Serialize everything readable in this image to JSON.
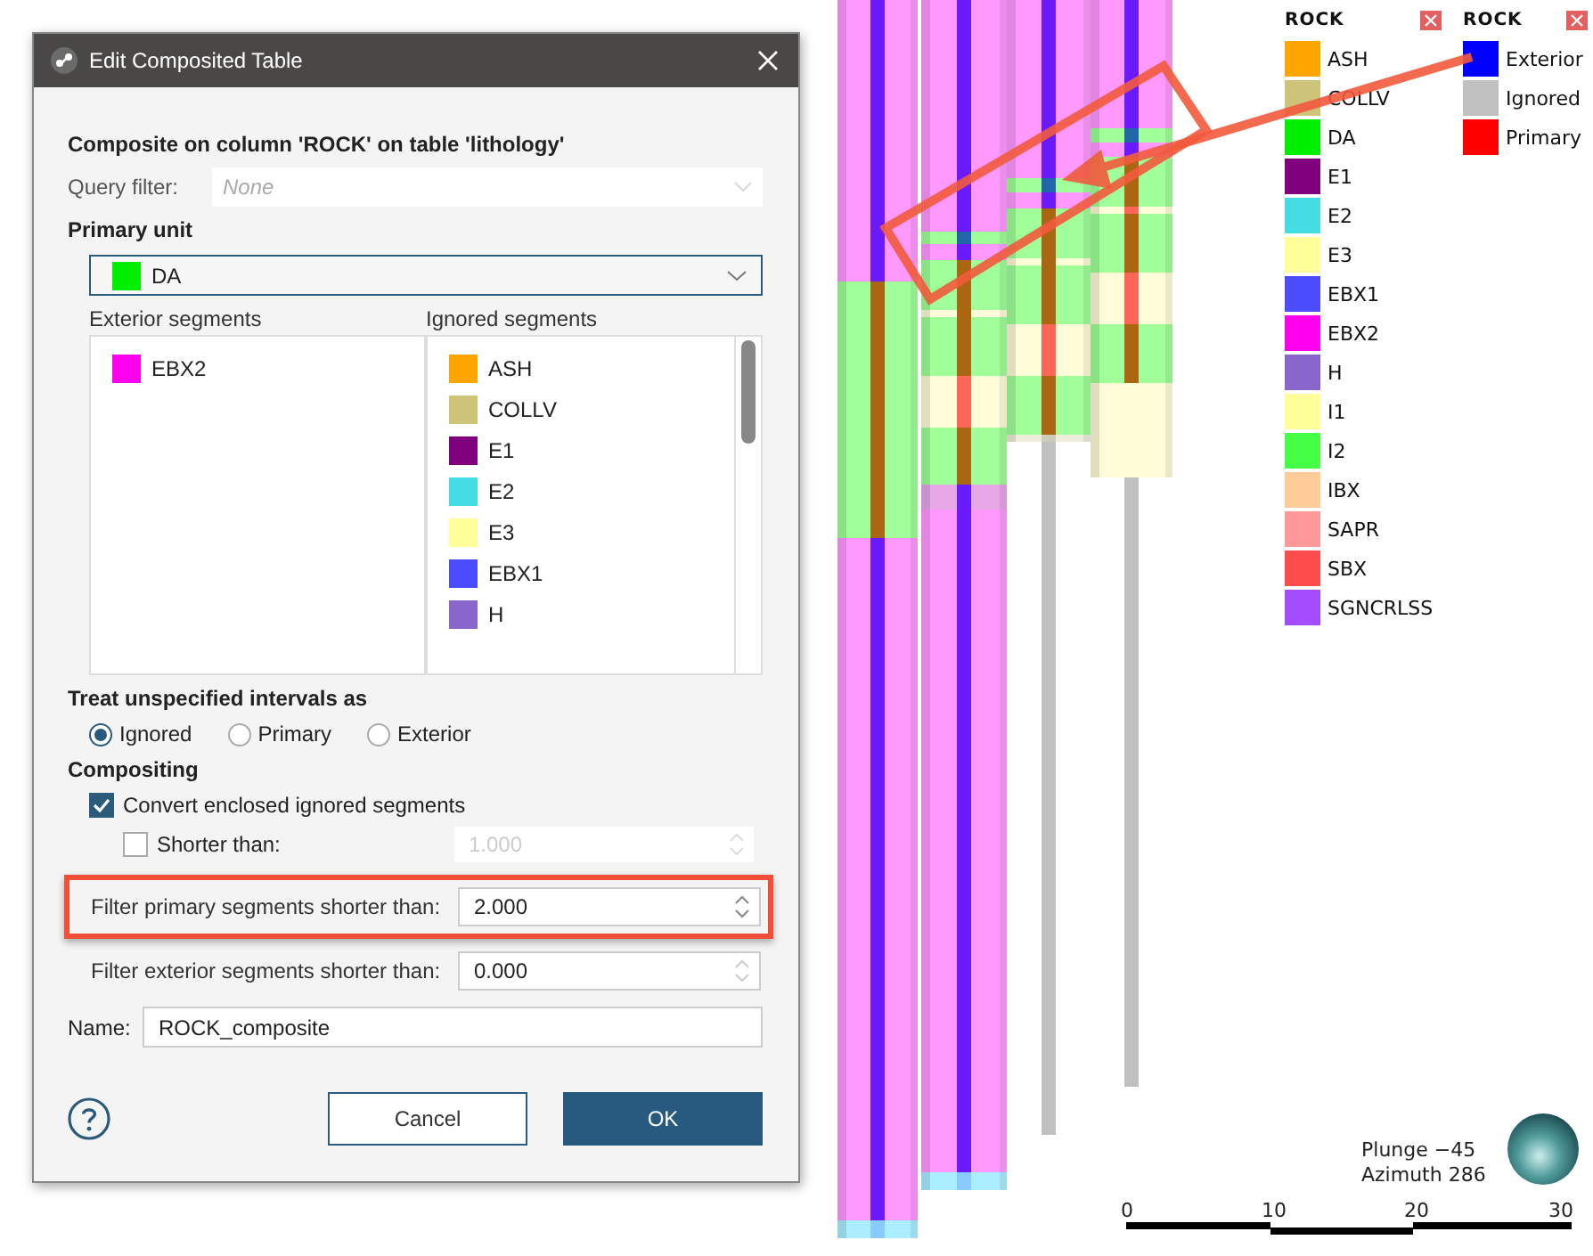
{
  "dialog": {
    "title": "Edit Composited Table",
    "heading": "Composite on column 'ROCK' on table 'lithology'",
    "query_filter": {
      "label": "Query filter:",
      "placeholder": "None"
    },
    "primary_unit": {
      "label": "Primary unit",
      "value": "DA",
      "color": "#00ee00"
    },
    "exterior_segments": {
      "label": "Exterior segments",
      "items": [
        {
          "name": "EBX2",
          "color": "#ff00ee"
        }
      ]
    },
    "ignored_segments": {
      "label": "Ignored segments",
      "items": [
        {
          "name": "ASH",
          "color": "#ffa500"
        },
        {
          "name": "COLLV",
          "color": "#cdc47a"
        },
        {
          "name": "E1",
          "color": "#800080"
        },
        {
          "name": "E2",
          "color": "#44dde6"
        },
        {
          "name": "E3",
          "color": "#ffff99"
        },
        {
          "name": "EBX1",
          "color": "#4c4cff"
        },
        {
          "name": "H",
          "color": "#8866cc"
        }
      ]
    },
    "treat_unspecified": {
      "label": "Treat unspecified intervals as",
      "options": [
        {
          "label": "Ignored",
          "selected": true
        },
        {
          "label": "Primary",
          "selected": false
        },
        {
          "label": "Exterior",
          "selected": false
        }
      ]
    },
    "compositing": {
      "label": "Compositing",
      "convert": {
        "label": "Convert enclosed ignored segments",
        "checked": true
      },
      "shorter_than": {
        "label": "Shorter than:",
        "checked": false,
        "value": "1.000"
      },
      "filter_primary": {
        "label": "Filter primary segments shorter than:",
        "value": "2.000",
        "highlighted": true
      },
      "filter_exterior": {
        "label": "Filter exterior segments shorter than:",
        "value": "0.000",
        "highlighted": false
      }
    },
    "name": {
      "label": "Name:",
      "value": "ROCK_composite"
    },
    "buttons": [
      {
        "label": "Cancel",
        "kind": "secondary"
      },
      {
        "label": "OK",
        "kind": "primary"
      }
    ]
  },
  "legends": [
    {
      "title": "ROCK",
      "items": [
        {
          "name": "ASH",
          "color": "#ffa500"
        },
        {
          "name": "COLLV",
          "color": "#cdc47a"
        },
        {
          "name": "DA",
          "color": "#00ee00"
        },
        {
          "name": "E1",
          "color": "#800080"
        },
        {
          "name": "E2",
          "color": "#44dde6"
        },
        {
          "name": "E3",
          "color": "#ffff99"
        },
        {
          "name": "EBX1",
          "color": "#4c4cff"
        },
        {
          "name": "EBX2",
          "color": "#ff00ee"
        },
        {
          "name": "H",
          "color": "#8866cc"
        },
        {
          "name": "I1",
          "color": "#ffff99"
        },
        {
          "name": "I2",
          "color": "#44ff44"
        },
        {
          "name": "IBX",
          "color": "#ffcc99"
        },
        {
          "name": "SAPR",
          "color": "#ff9999"
        },
        {
          "name": "SBX",
          "color": "#ff4c4c"
        },
        {
          "name": "SGNCRLSS",
          "color": "#a64cff"
        }
      ]
    },
    {
      "title": "ROCK",
      "items": [
        {
          "name": "Exterior",
          "color": "#0000ff"
        },
        {
          "name": "Ignored",
          "color": "#c0c0c0"
        },
        {
          "name": "Primary",
          "color": "#ff0000"
        }
      ]
    }
  ],
  "orientation": {
    "plunge": "Plunge −45",
    "azimuth": "Azimuth 286"
  },
  "scale_bar": {
    "ticks": [
      "0",
      "10",
      "20",
      "30"
    ]
  }
}
